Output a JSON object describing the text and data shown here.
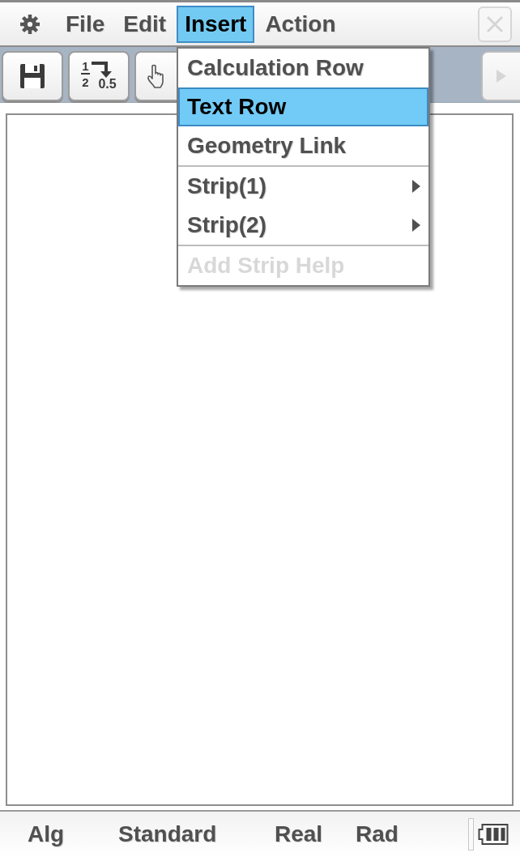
{
  "menu_bar": {
    "items": [
      {
        "label": "File",
        "selected": false
      },
      {
        "label": "Edit",
        "selected": false
      },
      {
        "label": "Insert",
        "selected": true
      },
      {
        "label": "Action",
        "selected": false
      }
    ],
    "close_button": {
      "disabled": true
    }
  },
  "toolbar": {
    "buttons": [
      {
        "kind": "save"
      },
      {
        "kind": "convert",
        "numerator": "1",
        "denominator": "2",
        "result": "0.5"
      },
      {
        "kind": "hand"
      }
    ],
    "scroll_button": {
      "disabled": true
    }
  },
  "dropdown_menu": {
    "groups": [
      {
        "items": [
          {
            "label": "Calculation Row",
            "selected": false,
            "disabled": false,
            "submenu": false
          },
          {
            "label": "Text Row",
            "selected": true,
            "disabled": false,
            "submenu": false
          },
          {
            "label": "Geometry Link",
            "selected": false,
            "disabled": false,
            "submenu": false
          }
        ]
      },
      {
        "items": [
          {
            "label": "Strip(1)",
            "selected": false,
            "disabled": false,
            "submenu": true
          },
          {
            "label": "Strip(2)",
            "selected": false,
            "disabled": false,
            "submenu": true
          }
        ]
      },
      {
        "items": [
          {
            "label": "Add Strip Help",
            "selected": false,
            "disabled": true,
            "submenu": false
          }
        ]
      }
    ]
  },
  "status_bar": {
    "items": [
      "Alg",
      "Standard",
      "Real",
      "Rad"
    ]
  }
}
